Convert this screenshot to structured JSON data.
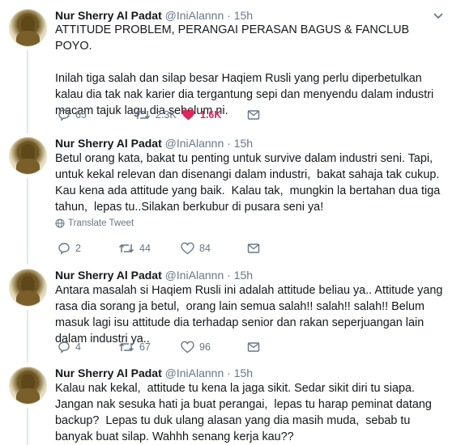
{
  "tweets": [
    {
      "name": "Nur Sherry Al Padat",
      "handle": "@IniAlannn",
      "dot": "·",
      "time": "15h",
      "text": "ATTITUDE PROBLEM, PERANGAI PERASAN BAGUS & FANCLUB POYO.\n\nInilah tiga salah dan silap besar Haqiem Rusli yang perlu diperbetulkan kalau dia tak nak karier dia tergantung sepi dan menyendu dalam industri macam tajuk lagu dia sebelum ni.",
      "replies": "65",
      "retweets": "2.3K",
      "likes": "1.6K",
      "liked": true
    },
    {
      "name": "Nur Sherry Al Padat",
      "handle": "@IniAlannn",
      "dot": "·",
      "time": "15h",
      "text": "Betul orang kata, bakat tu penting untuk survive dalam industri seni. Tapi,  untuk kekal relevan dan disenangi dalam industri,  bakat sahaja tak cukup. Kau kena ada attitude yang baik.  Kalau tak,  mungkin la bertahan dua tiga tahun,  lepas tu..Silakan berkubur di pusara seni ya!",
      "translate": "Translate Tweet",
      "replies": "2",
      "retweets": "44",
      "likes": "84",
      "liked": false
    },
    {
      "name": "Nur Sherry Al Padat",
      "handle": "@IniAlannn",
      "dot": "·",
      "time": "15h",
      "text": "Antara masalah si Haqiem Rusli ini adalah attitude beliau ya.. Attitude yang rasa dia sorang ja betul,  orang lain semua salah!! salah!! salah!! Belum masuk lagi isu attitude dia terhadap senior dan rakan seperjuangan lain dalam industri ya..",
      "replies": "4",
      "retweets": "67",
      "likes": "96",
      "liked": false
    },
    {
      "name": "Nur Sherry Al Padat",
      "handle": "@IniAlannn",
      "dot": "·",
      "time": "15h",
      "text": "Kalau nak kekal,  attitude tu kena la jaga sikit. Sedar sikit diri tu siapa. Jangan nak sesuka hati ja buat perangai,  lepas tu harap peminat datang backup?  Lepas tu duk ulang alasan yang dia masih muda,  sebab tu banyak buat silap. Wahhh senang kerja kau??"
    }
  ],
  "colors": {
    "text": "#14171a",
    "muted": "#657786",
    "like": "#e0245e",
    "thread_line": "#e1e8ed"
  },
  "icons": [
    "chevron-down-icon",
    "reply-icon",
    "retweet-icon",
    "heart-icon",
    "message-icon",
    "globe-icon"
  ]
}
